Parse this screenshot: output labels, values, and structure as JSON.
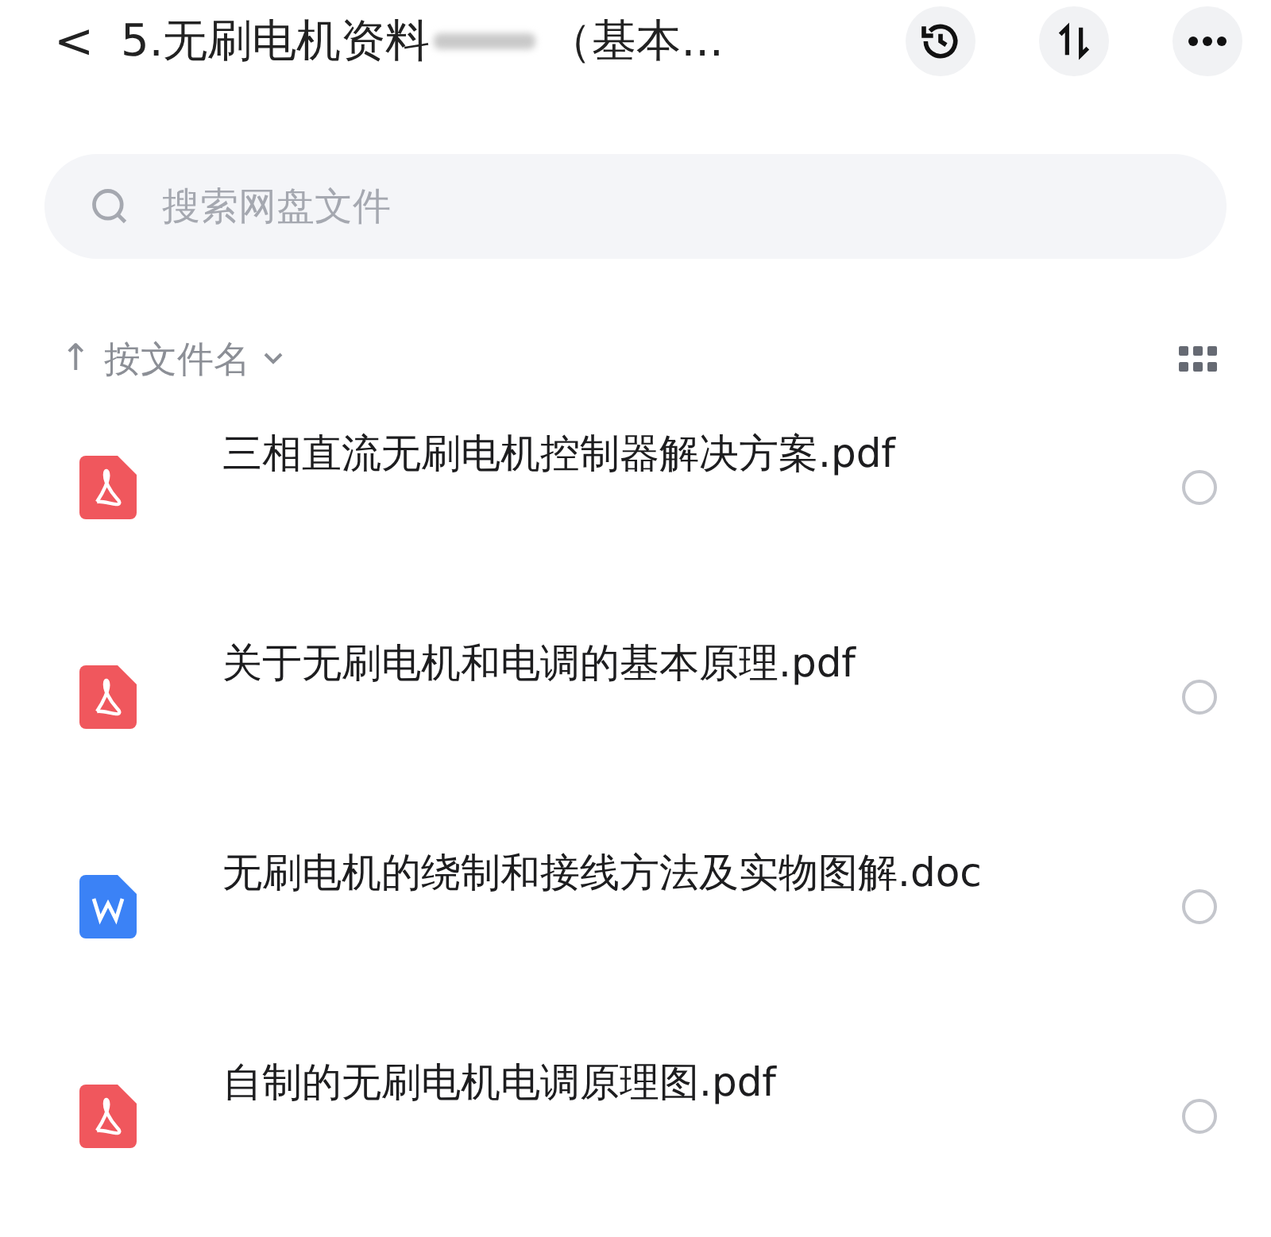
{
  "header": {
    "back": "<",
    "title_start": "5.无刷电机资料",
    "title_end": "（基本..."
  },
  "search": {
    "placeholder": "搜索网盘文件"
  },
  "sort": {
    "arrow": "↑",
    "label": "按文件名"
  },
  "files": [
    {
      "name": "三相直流无刷电机控制器解决方案.pdf",
      "kind": "pdf",
      "selected": false
    },
    {
      "name": "关于无刷电机和电调的基本原理.pdf",
      "kind": "pdf",
      "selected": false
    },
    {
      "name": "无刷电机的绕制和接线方法及实物图解.doc",
      "kind": "doc",
      "selected": false
    },
    {
      "name": "自制的无刷电机电调原理图.pdf",
      "kind": "pdf",
      "selected": false
    }
  ]
}
